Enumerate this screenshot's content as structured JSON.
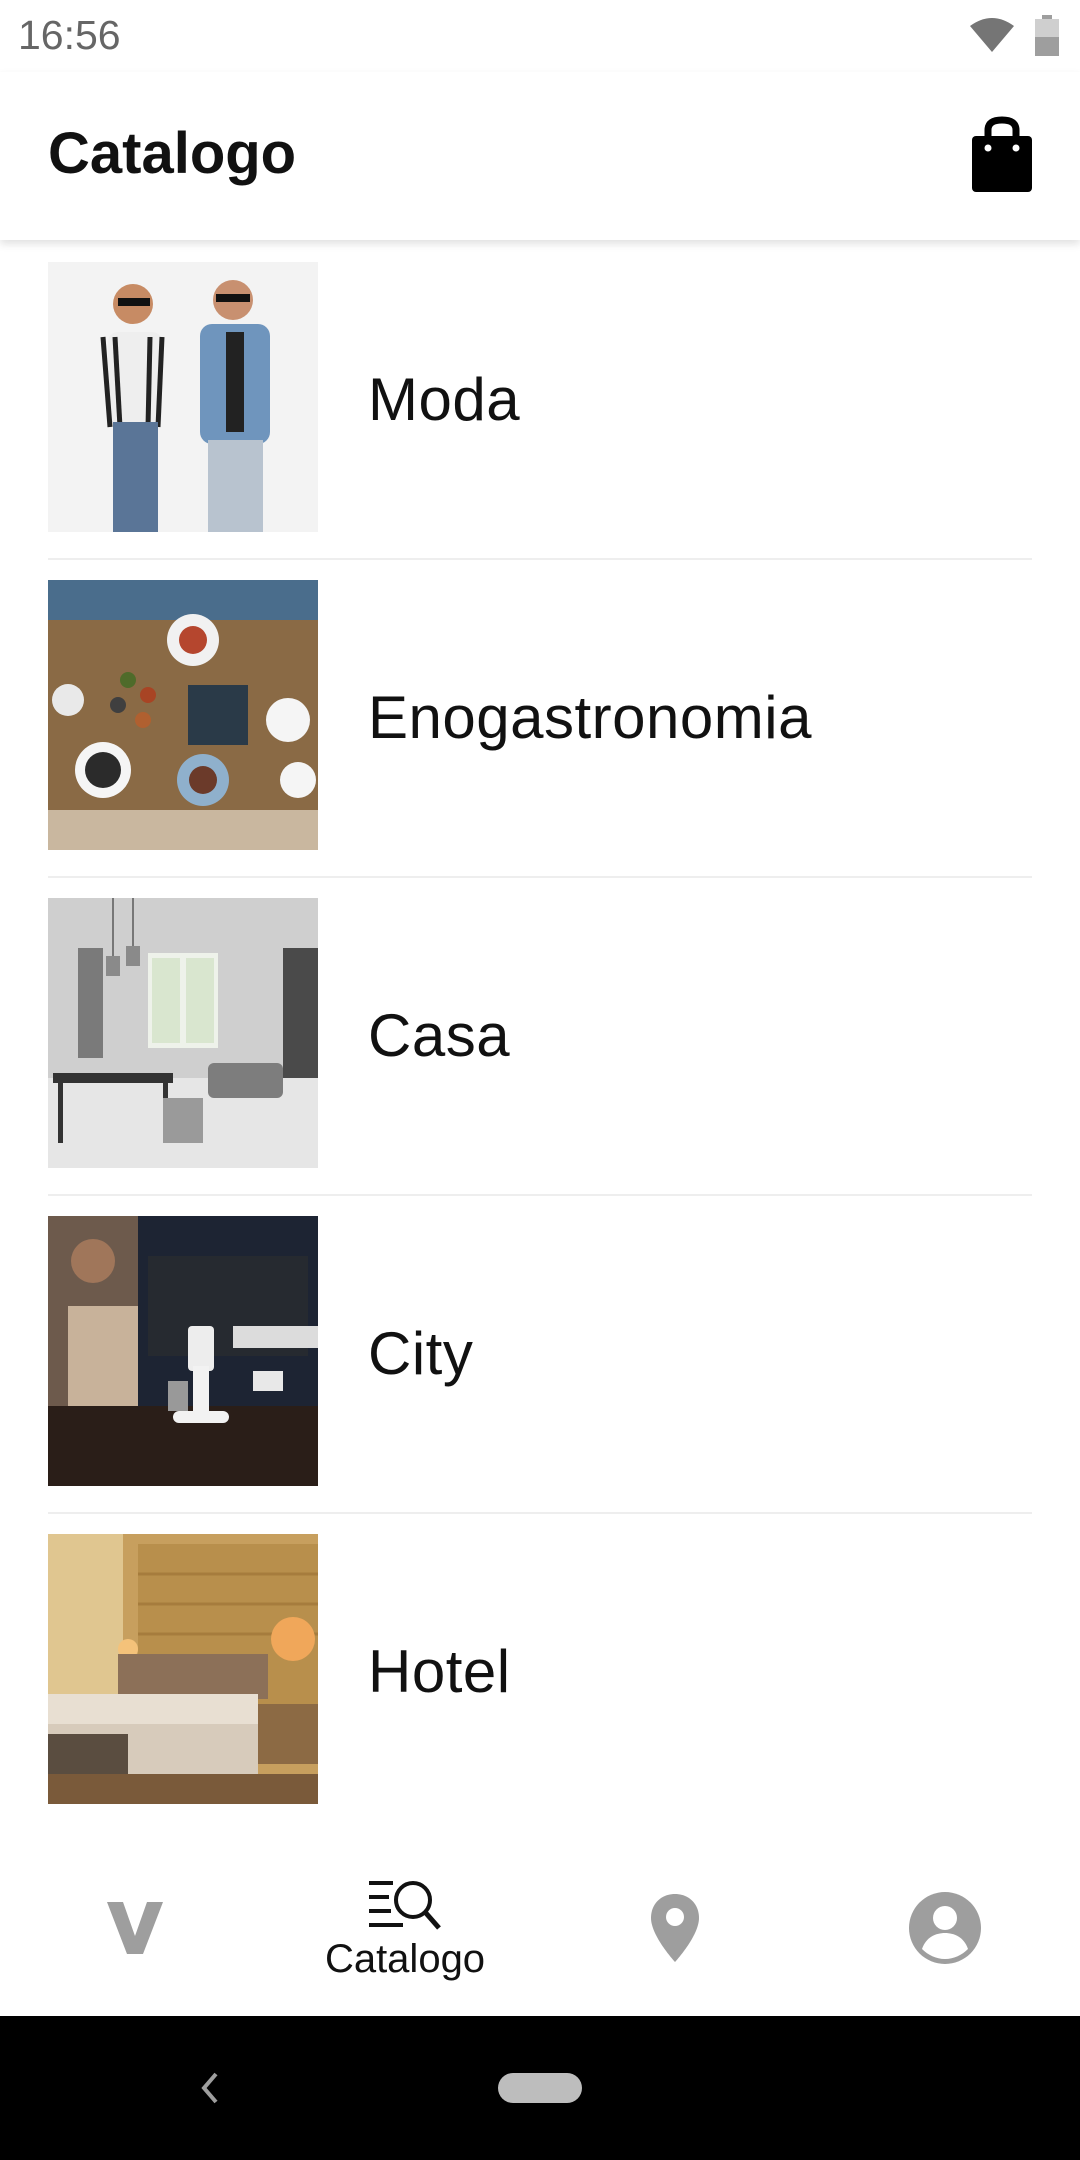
{
  "status_bar": {
    "time": "16:56",
    "icons": [
      "wifi-icon",
      "battery-icon"
    ]
  },
  "app_bar": {
    "title": "Catalogo",
    "action_icon": "shopping-bag-icon"
  },
  "categories": [
    {
      "label": "Moda",
      "image": "fashion-couple-photo"
    },
    {
      "label": "Enogastronomia",
      "image": "food-table-photo"
    },
    {
      "label": "Casa",
      "image": "living-room-photo"
    },
    {
      "label": "City",
      "image": "cafe-counter-photo"
    },
    {
      "label": "Hotel",
      "image": "hotel-bedroom-photo"
    }
  ],
  "bottom_nav": {
    "items": [
      {
        "icon": "v-logo-icon",
        "label": ""
      },
      {
        "icon": "catalog-search-icon",
        "label": "Catalogo",
        "active": true
      },
      {
        "icon": "location-pin-icon",
        "label": ""
      },
      {
        "icon": "account-icon",
        "label": ""
      }
    ]
  },
  "colors": {
    "inactive_icon": "#9e9e9e",
    "active": "#111111",
    "divider": "#eeeeee",
    "system_nav": "#000000"
  }
}
